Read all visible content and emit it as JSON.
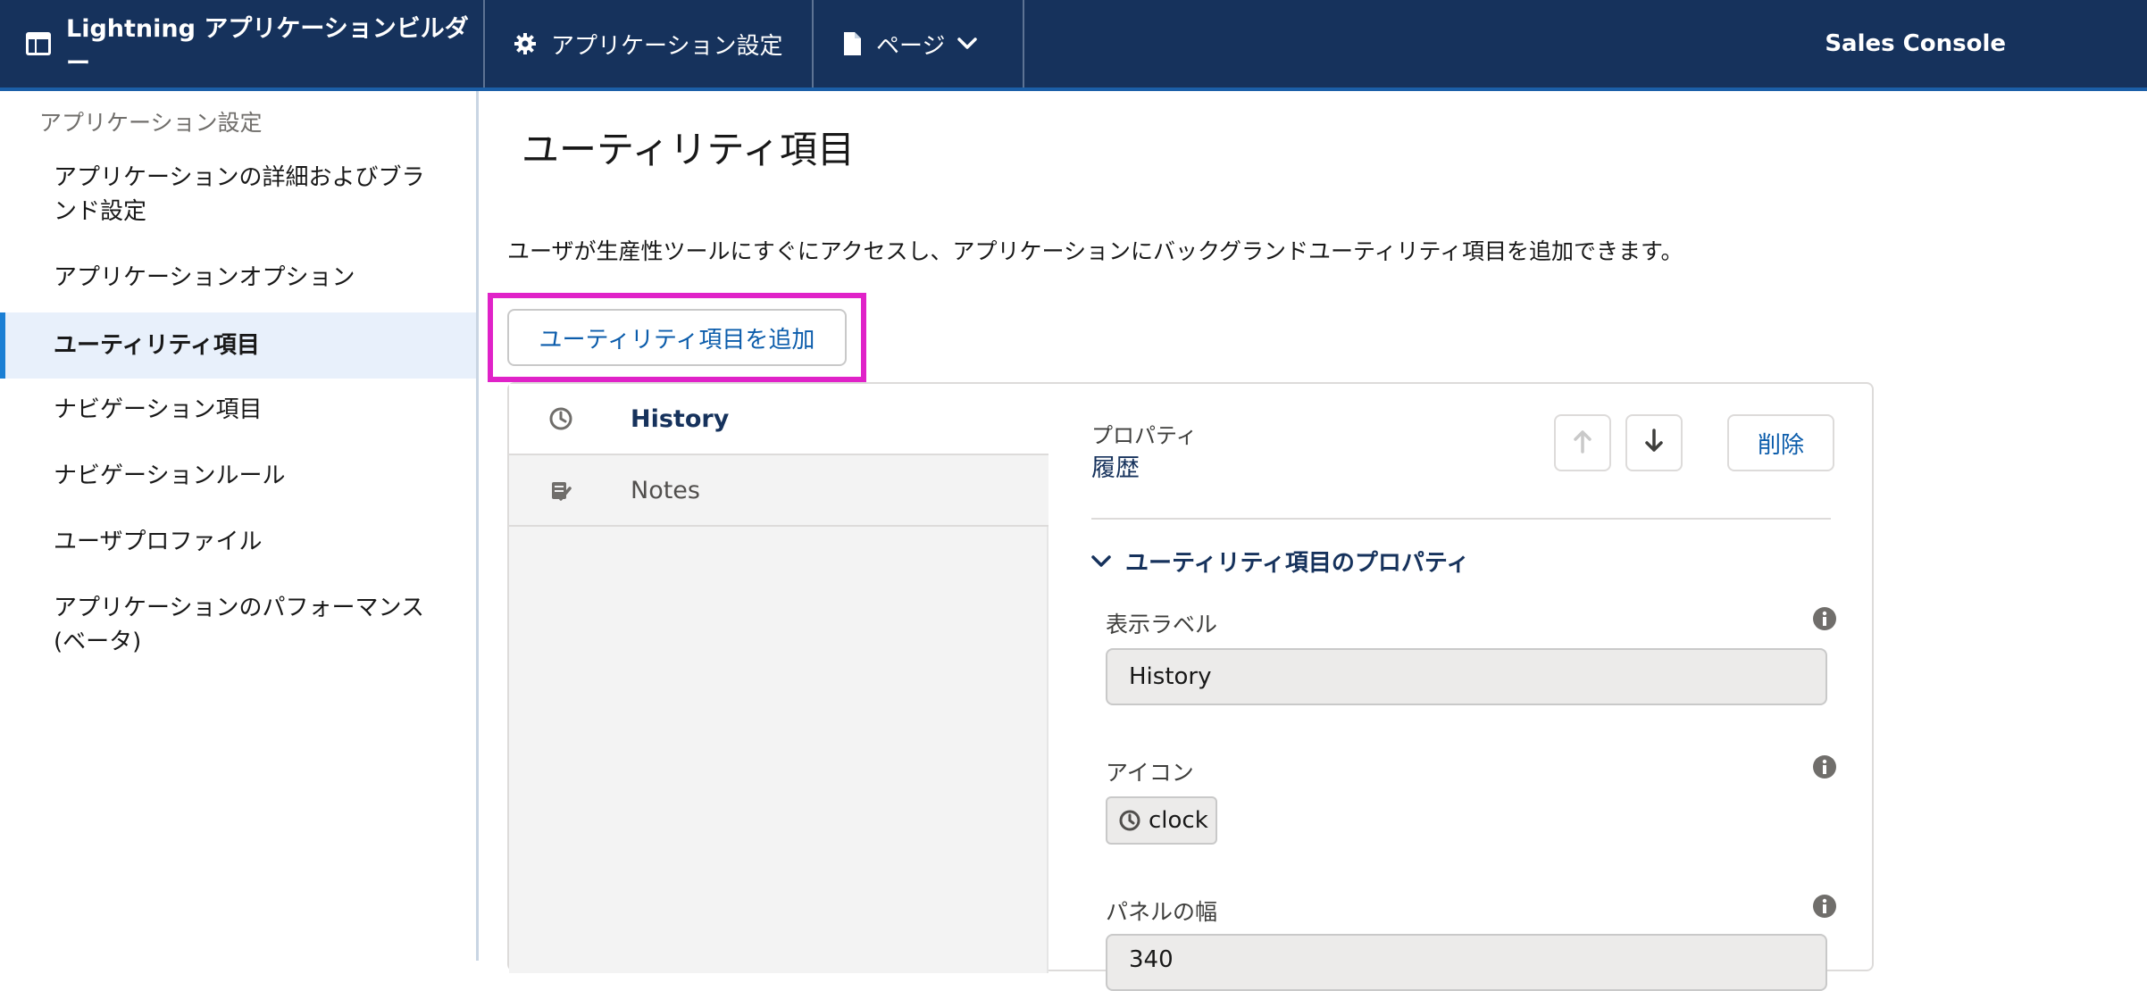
{
  "topbar": {
    "brand": "Lightning アプリケーションビルダー",
    "app_settings": "アプリケーション設定",
    "pages": "ページ",
    "app_name": "Sales Console"
  },
  "sidebar": {
    "heading": "アプリケーション設定",
    "items": [
      {
        "label": "アプリケーションの詳細およびブラ",
        "label2": "ンド設定"
      },
      {
        "label": "アプリケーションオプション"
      },
      {
        "label": "ユーティリティ項目",
        "active": true
      },
      {
        "label": "ナビゲーション項目"
      },
      {
        "label": "ナビゲーションルール"
      },
      {
        "label": "ユーザプロファイル"
      },
      {
        "label": "アプリケーションのパフォーマンス",
        "label2": "(ベータ)"
      }
    ]
  },
  "main": {
    "title": "ユーティリティ項目",
    "description": "ユーザが生産性ツールにすぐにアクセスし、アプリケーションにバックグランドユーティリティ項目を追加できます。",
    "add_button": "ユーティリティ項目を追加",
    "utility_list": [
      {
        "label": "History",
        "icon": "clock-icon"
      },
      {
        "label": "Notes",
        "icon": "notes-icon"
      }
    ],
    "properties": {
      "caption": "プロパティ",
      "value": "履歴",
      "delete_label": "削除",
      "section_title": "ユーティリティ項目のプロパティ",
      "display_label_caption": "表示ラベル",
      "display_label_value": "History",
      "icon_caption": "アイコン",
      "icon_value": "clock",
      "panel_width_caption": "パネルの幅",
      "panel_width_value": "340"
    }
  },
  "colors": {
    "topbar": "#16325c",
    "accent": "#0b5cab",
    "highlight": "#e022c8",
    "active_bg": "#e8f0fb"
  }
}
